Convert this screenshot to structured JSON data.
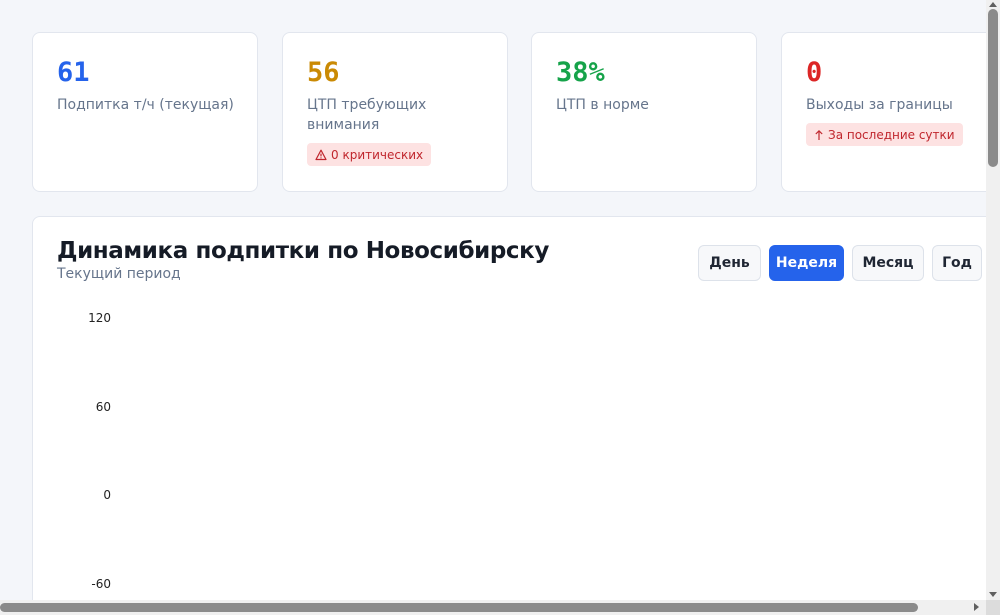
{
  "kpis": [
    {
      "value": "61",
      "label": "Подпитка т/ч (текущая)",
      "color": "#2563eb"
    },
    {
      "value": "56",
      "label": "ЦТП требующих внимания",
      "color": "#ca8a04",
      "badge": {
        "icon": "alert-triangle-icon",
        "text": "0 критических"
      }
    },
    {
      "value": "38%",
      "label": "ЦТП в норме",
      "color": "#16a34a"
    },
    {
      "value": "0",
      "label": "Выходы за границы",
      "color": "#dc2626",
      "badge": {
        "icon": "arrow-up-icon",
        "text": "За последние сутки"
      }
    }
  ],
  "chart_panel": {
    "title": "Динамика подпитки по Новосибирску",
    "subtitle": "Текущий период",
    "period_buttons": [
      {
        "label": "День",
        "active": false
      },
      {
        "label": "Неделя",
        "active": true
      },
      {
        "label": "Месяц",
        "active": false
      },
      {
        "label": "Год",
        "active": false
      }
    ]
  },
  "chart_data": {
    "type": "line",
    "title": "",
    "xlabel": "",
    "ylabel": "",
    "y_ticks": [
      120,
      60,
      0,
      -60
    ],
    "series": []
  },
  "colors": {
    "accent": "#2563eb",
    "warning": "#ca8a04",
    "success": "#16a34a",
    "danger": "#dc2626"
  }
}
